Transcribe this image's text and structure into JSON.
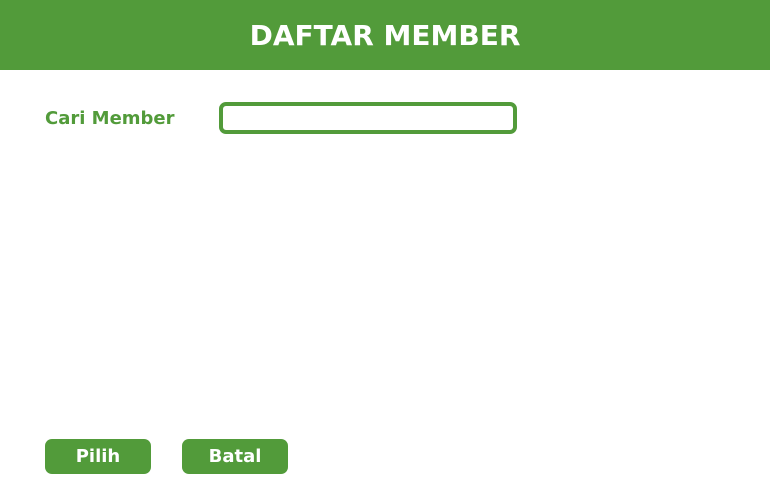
{
  "header": {
    "title": "DAFTAR MEMBER"
  },
  "search": {
    "label": "Cari Member",
    "value": "",
    "placeholder": ""
  },
  "actions": {
    "select_label": "Pilih",
    "cancel_label": "Batal"
  },
  "colors": {
    "accent": "#529b3a",
    "background": "#ffffff",
    "text_on_accent": "#ffffff"
  }
}
